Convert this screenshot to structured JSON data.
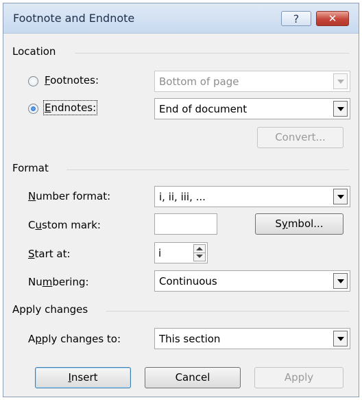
{
  "dialog": {
    "title": "Footnote and Endnote",
    "help_glyph": "?",
    "close_glyph": "✕"
  },
  "location": {
    "section_label": "Location",
    "footnotes": {
      "accel": "F",
      "rest": "ootnotes:",
      "selected": false,
      "value": "Bottom of page",
      "enabled": false
    },
    "endnotes": {
      "accel": "E",
      "rest": "ndnotes:",
      "selected": true,
      "value": "End of document",
      "enabled": true
    },
    "convert_label": "Convert..."
  },
  "format": {
    "section_label": "Format",
    "number_format": {
      "accel": "N",
      "rest": "umber format:",
      "value": "i, ii, iii, ..."
    },
    "custom_mark": {
      "pre": "C",
      "accel": "u",
      "rest": "stom mark:",
      "value": ""
    },
    "symbol_button": {
      "pre": "S",
      "accel": "y",
      "rest": "mbol..."
    },
    "start_at": {
      "accel": "S",
      "rest": "tart at:",
      "value": "i"
    },
    "numbering": {
      "pre": "Nu",
      "accel": "m",
      "rest": "bering:",
      "value": "Continuous"
    }
  },
  "apply": {
    "section_label": "Apply changes",
    "apply_to": {
      "pre": "A",
      "accel": "p",
      "rest": "ply changes to:",
      "value": "This section"
    }
  },
  "buttons": {
    "insert": {
      "accel": "I",
      "rest": "nsert"
    },
    "cancel": "Cancel",
    "apply": "Apply"
  }
}
